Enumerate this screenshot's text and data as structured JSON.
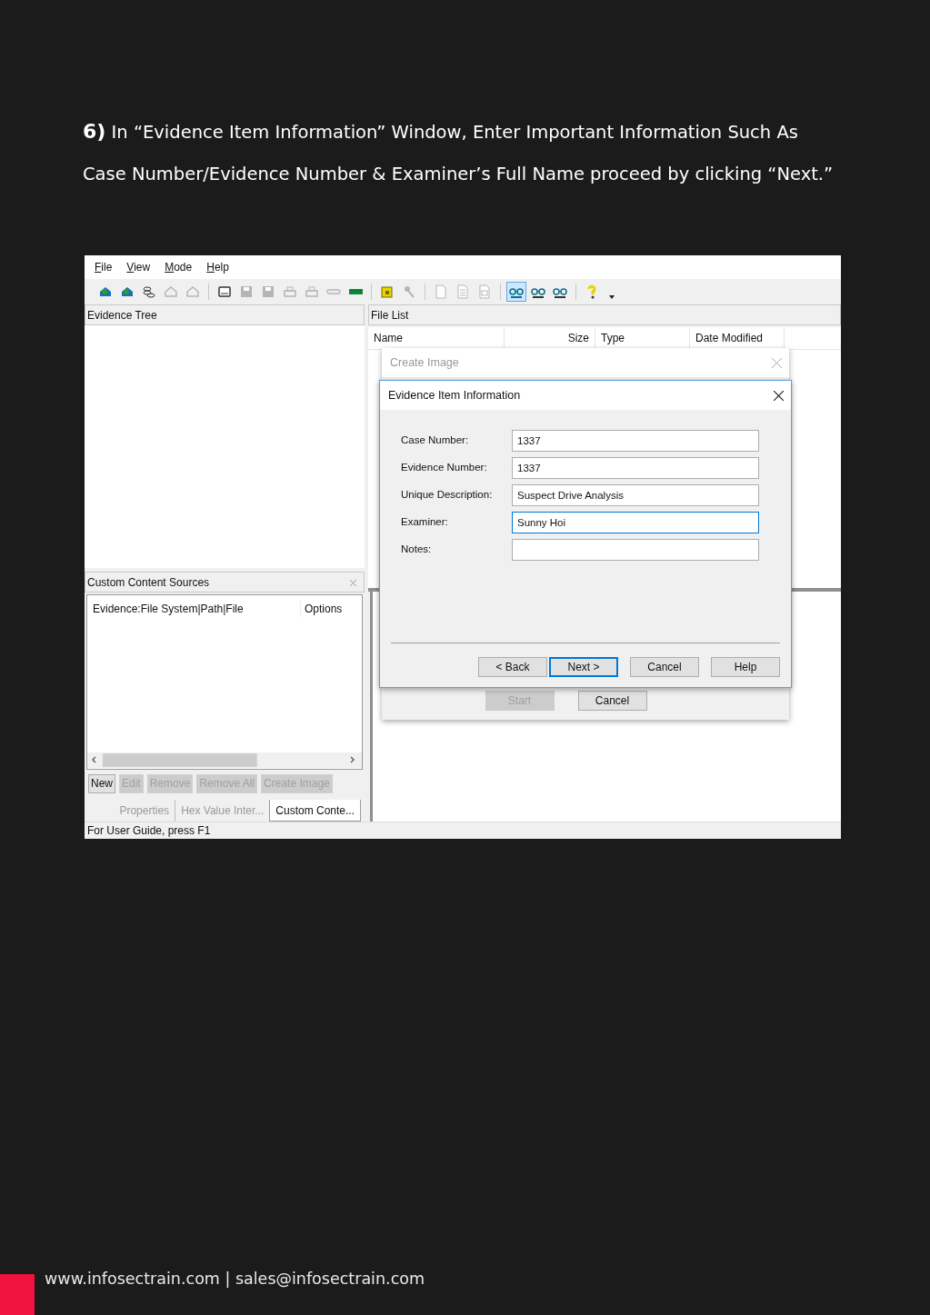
{
  "heading": {
    "text": "**6)** In “Evidence Item Information” Window, Enter Important Information Such As Case Number/Evidence Number & Examiner’s Full Name proceed by clicking “Next.”"
  },
  "app": {
    "menu": [
      "File",
      "View",
      "Mode",
      "Help"
    ],
    "toolbar": [
      [
        {
          "disabled": false,
          "selected": false
        },
        {
          "disabled": false,
          "selected": false
        },
        {
          "disabled": false,
          "selected": false
        },
        {
          "disabled": true,
          "selected": false
        },
        {
          "disabled": true,
          "selected": false
        }
      ],
      [
        {
          "disabled": false,
          "selected": false
        },
        {
          "disabled": true,
          "selected": false
        },
        {
          "disabled": true,
          "selected": false
        },
        {
          "disabled": true,
          "selected": false
        },
        {
          "disabled": true,
          "selected": false
        },
        {
          "disabled": true,
          "selected": false
        },
        {
          "disabled": false,
          "selected": false
        }
      ],
      [
        {
          "disabled": false,
          "selected": false
        },
        {
          "disabled": true,
          "selected": false
        }
      ],
      [
        {
          "disabled": true,
          "selected": false
        },
        {
          "disabled": true,
          "selected": false
        },
        {
          "disabled": true,
          "selected": false
        }
      ],
      [
        {
          "disabled": false,
          "selected": true
        },
        {
          "disabled": false,
          "selected": false
        },
        {
          "disabled": false,
          "selected": false
        }
      ],
      [
        {
          "disabled": false,
          "selected": false
        }
      ]
    ],
    "evidence_tree": {
      "title": "Evidence Tree"
    },
    "custom_content_sources": {
      "title": "Custom Content Sources",
      "columns": [
        "Evidence:File System|Path|File",
        "Options"
      ],
      "buttons": [
        {
          "label": "New",
          "disabled": false
        },
        {
          "label": "Edit",
          "disabled": true
        },
        {
          "label": "Remove",
          "disabled": true
        },
        {
          "label": "Remove All",
          "disabled": true
        },
        {
          "label": "Create Image",
          "disabled": true
        }
      ]
    },
    "tabs": [
      {
        "label": "Properties",
        "selected": false
      },
      {
        "label": "Hex Value Inter...",
        "selected": false
      },
      {
        "label": "Custom Conte...",
        "selected": true
      }
    ],
    "file_list": {
      "title": "File List",
      "columns": [
        "Name",
        "Size",
        "Type",
        "Date Modified"
      ]
    },
    "status_bar": "For User Guide, press F1",
    "create_image_dialog": {
      "title": "Create Image",
      "buttons": [
        {
          "label": "Start",
          "disabled": true
        },
        {
          "label": "Cancel",
          "disabled": false
        }
      ]
    },
    "evidence_dialog": {
      "title": "Evidence Item Information",
      "fields": [
        {
          "label": "Case Number:",
          "value": "1337",
          "focused": false
        },
        {
          "label": "Evidence Number:",
          "value": "1337",
          "focused": false
        },
        {
          "label": "Unique Description:",
          "value": "Suspect Drive Analysis",
          "focused": false
        },
        {
          "label": "Examiner:",
          "value": "Sunny Hoi",
          "focused": true
        },
        {
          "label": "Notes:",
          "focused": false
        }
      ],
      "buttons": [
        {
          "label": "< Back",
          "default": false
        },
        {
          "label": "Next >",
          "default": true
        },
        {
          "label": "Cancel",
          "default": false
        },
        {
          "label": "Help",
          "default": false
        }
      ]
    }
  },
  "footer": {
    "text": "www.infosectrain.com | sales@infosectrain.com"
  }
}
